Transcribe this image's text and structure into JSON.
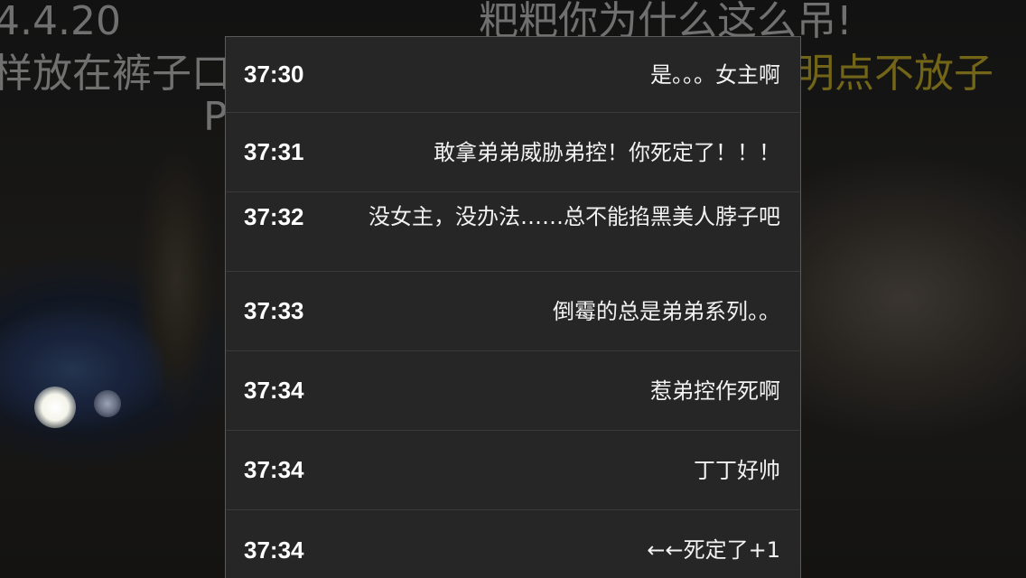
{
  "video": {
    "danmaku": [
      {
        "text": "4.4.20"
      },
      {
        "text": "粑粑你为什么这么吊!"
      },
      {
        "text": "样放在裤子口"
      },
      {
        "text": "P"
      },
      {
        "text": "明点不放子"
      }
    ]
  },
  "comments": [
    {
      "time": "37:30",
      "text": "是。。。女主啊"
    },
    {
      "time": "37:31",
      "text": "敢拿弟弟威胁弟控！你死定了！！！"
    },
    {
      "time": "37:32",
      "text": "没女主，没办法……总不能掐黑美人脖子吧"
    },
    {
      "time": "37:33",
      "text": "倒霉的总是弟弟系列。。"
    },
    {
      "time": "37:34",
      "text": "惹弟控作死啊"
    },
    {
      "time": "37:34",
      "text": "丁丁好帅"
    },
    {
      "time": "37:34",
      "text": "←←死定了+1"
    }
  ]
}
